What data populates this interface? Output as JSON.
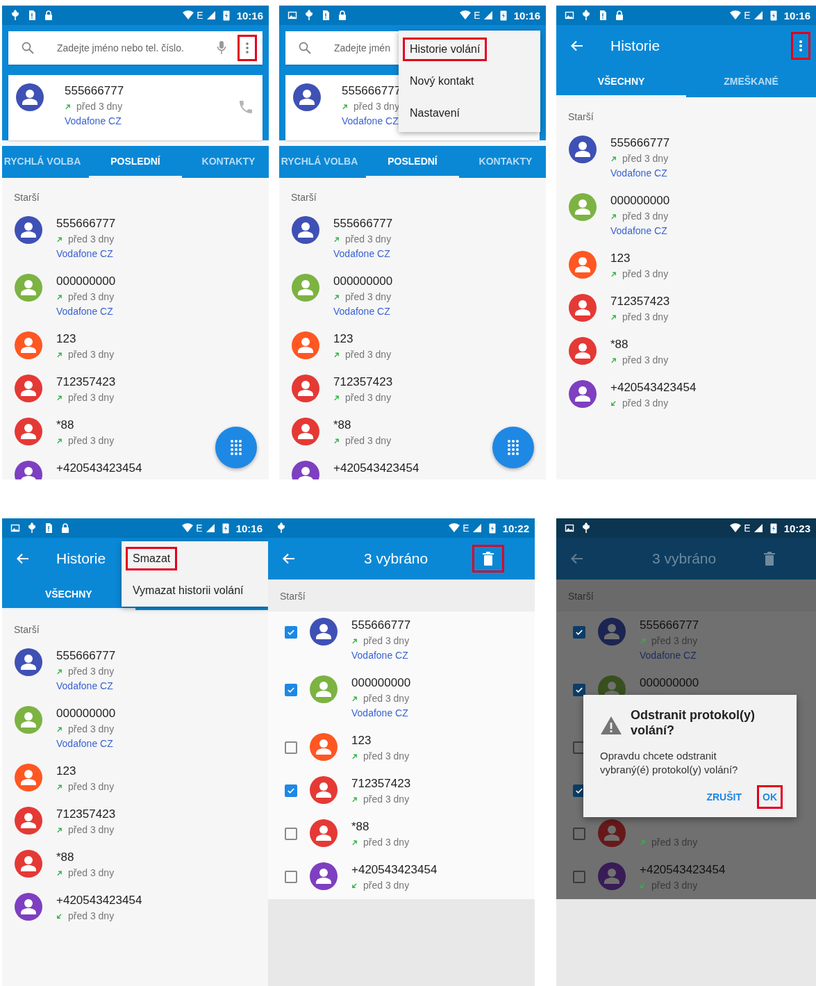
{
  "screens": [
    {
      "kind": "dialer",
      "dimmed": false,
      "status_bar": {
        "icons": [
          {
            "kind": "usb"
          },
          {
            "kind": "sim"
          },
          {
            "kind": "lock"
          }
        ],
        "network": "E",
        "time": "10:16"
      },
      "search": {
        "placeholder": "Zadejte jméno nebo tel. číslo.",
        "mic": true,
        "overflow": {
          "highlighted": true
        }
      },
      "recent_card": {
        "number": "555666777",
        "incoming": false,
        "time": "před 3 dny",
        "carrier": "Vodafone CZ",
        "color": "#3f51b5",
        "call_button": true
      },
      "tabs": [
        {
          "label": "RYCHLÁ VOLBA",
          "selected": false
        },
        {
          "label": "POSLEDNÍ",
          "selected": true
        },
        {
          "label": "KONTAKTY",
          "selected": false
        }
      ],
      "section": "Starší",
      "calls": [
        {
          "number": "555666777",
          "incoming": false,
          "time": "před 3 dny",
          "carrier": "Vodafone CZ",
          "color": "#3f51b5"
        },
        {
          "number": "000000000",
          "incoming": false,
          "time": "před 3 dny",
          "carrier": "Vodafone CZ",
          "color": "#7cb342"
        },
        {
          "number": "123",
          "incoming": false,
          "time": "před 3 dny",
          "color": "#ff5722"
        },
        {
          "number": "712357423",
          "incoming": false,
          "time": "před 3 dny",
          "color": "#e53935"
        },
        {
          "number": "*88",
          "incoming": false,
          "time": "před 3 dny",
          "color": "#e53935"
        },
        {
          "number": "+420543423454",
          "color": "#7e3fc0"
        }
      ],
      "fab": true
    },
    {
      "kind": "dialer",
      "dimmed": false,
      "status_bar": {
        "icons": [
          {
            "kind": "image"
          },
          {
            "kind": "usb"
          },
          {
            "kind": "sim"
          },
          {
            "kind": "lock"
          }
        ],
        "network": "E",
        "time": "10:16"
      },
      "search": {
        "placeholder": "Zadejte jmén"
      },
      "recent_card": {
        "number": "555666777",
        "incoming": false,
        "time": "před 3 dny",
        "carrier": "Vodafone CZ",
        "color": "#3f51b5"
      },
      "tabs": [
        {
          "label": "RYCHLÁ VOLBA",
          "selected": false
        },
        {
          "label": "POSLEDNÍ",
          "selected": true
        },
        {
          "label": "KONTAKTY",
          "selected": false
        }
      ],
      "section": "Starší",
      "calls": [
        {
          "number": "555666777",
          "incoming": false,
          "time": "před 3 dny",
          "carrier": "Vodafone CZ",
          "color": "#3f51b5"
        },
        {
          "number": "000000000",
          "incoming": false,
          "time": "před 3 dny",
          "carrier": "Vodafone CZ",
          "color": "#7cb342"
        },
        {
          "number": "123",
          "incoming": false,
          "time": "před 3 dny",
          "color": "#ff5722"
        },
        {
          "number": "712357423",
          "incoming": false,
          "time": "před 3 dny",
          "color": "#e53935"
        },
        {
          "number": "*88",
          "incoming": false,
          "time": "před 3 dny",
          "color": "#e53935"
        },
        {
          "number": "+420543423454",
          "color": "#7e3fc0"
        }
      ],
      "fab": true,
      "menu": [
        {
          "label": "Historie volání",
          "highlighted": true
        },
        {
          "label": "Nový kontakt",
          "highlighted": false
        },
        {
          "label": "Nastavení",
          "highlighted": false
        }
      ]
    },
    {
      "kind": "history",
      "dimmed": false,
      "status_bar": {
        "icons": [
          {
            "kind": "image"
          },
          {
            "kind": "usb"
          },
          {
            "kind": "sim"
          },
          {
            "kind": "lock"
          }
        ],
        "network": "E",
        "time": "10:16"
      },
      "app_bar": {
        "title": "Historie",
        "overflow": {
          "highlighted": true
        }
      },
      "tabs": [
        {
          "label": "VŠECHNY",
          "selected": true
        },
        {
          "label": "ZMEŠKANÉ",
          "selected": false
        }
      ],
      "section": "Starší",
      "calls": [
        {
          "number": "555666777",
          "incoming": false,
          "time": "před 3 dny",
          "carrier": "Vodafone CZ",
          "color": "#3f51b5"
        },
        {
          "number": "000000000",
          "incoming": false,
          "time": "před 3 dny",
          "carrier": "Vodafone CZ",
          "color": "#7cb342"
        },
        {
          "number": "123",
          "incoming": false,
          "time": "před 3 dny",
          "color": "#ff5722"
        },
        {
          "number": "712357423",
          "incoming": false,
          "time": "před 3 dny",
          "color": "#e53935"
        },
        {
          "number": "*88",
          "incoming": false,
          "time": "před 3 dny",
          "color": "#e53935"
        },
        {
          "number": "+420543423454",
          "incoming": true,
          "time": "před 3 dny",
          "color": "#7e3fc0"
        }
      ]
    },
    {
      "kind": "history",
      "dimmed": false,
      "status_bar": {
        "icons": [
          {
            "kind": "image"
          },
          {
            "kind": "usb"
          },
          {
            "kind": "sim"
          },
          {
            "kind": "lock"
          }
        ],
        "network": "E",
        "time": "10:16"
      },
      "app_bar": {
        "title": "Historie"
      },
      "tabs": [
        {
          "label": "VŠECHNY",
          "selected": true
        }
      ],
      "section": "Starší",
      "calls": [
        {
          "number": "555666777",
          "incoming": false,
          "time": "před 3 dny",
          "carrier": "Vodafone CZ",
          "color": "#3f51b5"
        },
        {
          "number": "000000000",
          "incoming": false,
          "time": "před 3 dny",
          "carrier": "Vodafone CZ",
          "color": "#7cb342"
        },
        {
          "number": "123",
          "incoming": false,
          "time": "před 3 dny",
          "color": "#ff5722"
        },
        {
          "number": "712357423",
          "incoming": false,
          "time": "před 3 dny",
          "color": "#e53935"
        },
        {
          "number": "*88",
          "incoming": false,
          "time": "před 3 dny",
          "color": "#e53935"
        },
        {
          "number": "+420543423454",
          "incoming": true,
          "time": "před 3 dny",
          "color": "#7e3fc0"
        }
      ],
      "menu": [
        {
          "label": "Smazat",
          "highlighted": true
        },
        {
          "label": "Vymazat historii volání",
          "highlighted": false
        }
      ]
    },
    {
      "kind": "selection",
      "dimmed": false,
      "status_bar": {
        "icons": [
          {
            "kind": "usb"
          }
        ],
        "network": "E",
        "time": "10:22"
      },
      "app_bar": {
        "title": "3 vybráno",
        "delete": {
          "highlighted": true
        }
      },
      "section": "Starší",
      "calls": [
        {
          "number": "555666777",
          "incoming": false,
          "time": "před 3 dny",
          "carrier": "Vodafone CZ",
          "color": "#3f51b5",
          "checked": true
        },
        {
          "number": "000000000",
          "incoming": false,
          "time": "před 3 dny",
          "carrier": "Vodafone CZ",
          "color": "#7cb342",
          "checked": true
        },
        {
          "number": "123",
          "incoming": false,
          "time": "před 3 dny",
          "color": "#ff5722",
          "checked": false
        },
        {
          "number": "712357423",
          "incoming": false,
          "time": "před 3 dny",
          "color": "#e53935",
          "checked": true
        },
        {
          "number": "*88",
          "incoming": false,
          "time": "před 3 dny",
          "color": "#e53935",
          "checked": false
        },
        {
          "number": "+420543423454",
          "incoming": true,
          "time": "před 3 dny",
          "color": "#7e3fc0",
          "checked": false
        }
      ]
    },
    {
      "kind": "selection",
      "dimmed": true,
      "status_bar": {
        "icons": [
          {
            "kind": "image"
          },
          {
            "kind": "usb"
          }
        ],
        "network": "E",
        "time": "10:23"
      },
      "app_bar": {
        "title": "3 vybráno",
        "delete": {
          "highlighted": false
        }
      },
      "section": "Starší",
      "calls": [
        {
          "number": "555666777",
          "incoming": false,
          "time": "před 3 dny",
          "carrier": "Vodafone CZ",
          "color": "#1c2451",
          "checked": true
        },
        {
          "number": "000000000",
          "color": "#38501e",
          "checked": true,
          "carrier_covered": true
        },
        {
          "checked": false
        },
        {
          "checked": true
        },
        {
          "incoming": false,
          "time": "před 3 dny",
          "color": "#67191a",
          "checked": false
        },
        {
          "number": "+420543423454",
          "incoming": true,
          "time": "před 3 dny",
          "color": "#391c56",
          "checked": false
        }
      ],
      "dialog": {
        "title": "Odstranit protokol(y) volání?",
        "message": "Opravdu chcete odstranit vybraný(é) protokol(y) volání?",
        "buttons": [
          {
            "label": "ZRUŠIT",
            "highlighted": false
          },
          {
            "label": "OK",
            "highlighted": true
          }
        ]
      }
    }
  ]
}
